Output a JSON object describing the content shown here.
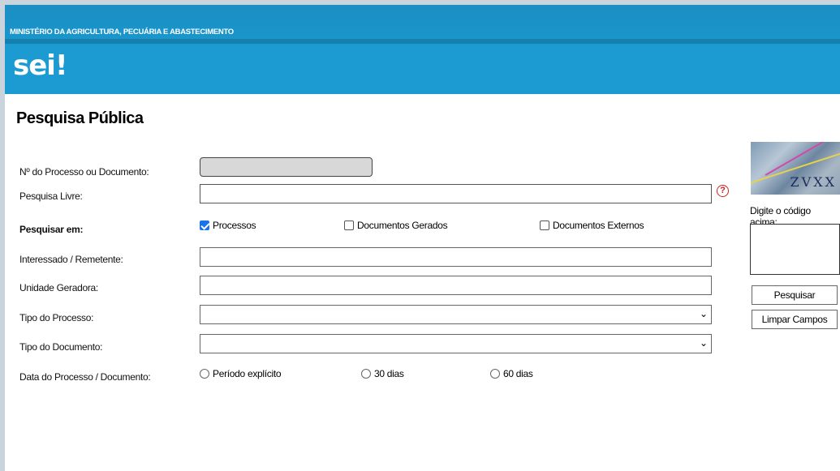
{
  "header": {
    "ministry": "MINISTÉRIO DA AGRICULTURA, PECUÁRIA E ABASTECIMENTO",
    "logo": "sei",
    "logo_mark": "!"
  },
  "page": {
    "title": "Pesquisa Pública"
  },
  "form": {
    "processo_label": "Nº do Processo ou Documento:",
    "pesquisa_livre_label": "Pesquisa Livre:",
    "pesquisar_em_label": "Pesquisar em:",
    "check_processos": "Processos",
    "check_docs_gerados": "Documentos Gerados",
    "check_docs_externos": "Documentos Externos",
    "interessado_label": "Interessado / Remetente:",
    "unidade_label": "Unidade Geradora:",
    "tipo_processo_label": "Tipo do Processo:",
    "tipo_documento_label": "Tipo do Documento:",
    "data_label": "Data do Processo / Documento:",
    "radio_periodo": "Período explícito",
    "radio_30": "30 dias",
    "radio_60": "60 dias",
    "help_symbol": "?"
  },
  "captcha": {
    "text": "ZVXX",
    "label": "Digite o código acima:"
  },
  "buttons": {
    "pesquisar": "Pesquisar",
    "limpar": "Limpar Campos"
  },
  "icons": {
    "select_arrow": "chevron-down-icon",
    "help": "help-icon"
  },
  "colors": {
    "header": "#1b9bd1",
    "checkbox_checked": "#1a73e8",
    "help": "#cc2222"
  }
}
